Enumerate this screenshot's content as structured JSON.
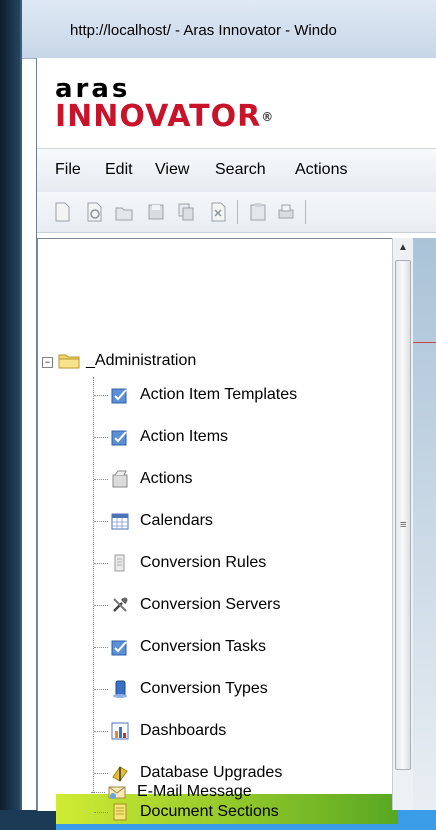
{
  "window": {
    "title": "http://localhost/ - Aras Innovator - Windo"
  },
  "logo": {
    "top": "aras",
    "main": "INNOVATOR",
    "reg": "®"
  },
  "menu": [
    "File",
    "Edit",
    "View",
    "Search",
    "Actions"
  ],
  "toolbar": {
    "icons": [
      "new-document-icon",
      "view-icon",
      "open-icon",
      "save-icon",
      "copy-icon",
      "delete-icon",
      "clipboard-icon",
      "print-icon"
    ]
  },
  "tree": {
    "root": {
      "label": "_Administration",
      "expander": "−"
    },
    "items": [
      {
        "label": "Action Item Templates",
        "icon": "action-item-templates-icon"
      },
      {
        "label": "Action Items",
        "icon": "action-items-icon"
      },
      {
        "label": "Actions",
        "icon": "actions-icon"
      },
      {
        "label": "Calendars",
        "icon": "calendar-icon"
      },
      {
        "label": "Conversion Rules",
        "icon": "conversion-rules-icon"
      },
      {
        "label": "Conversion Servers",
        "icon": "conversion-servers-icon"
      },
      {
        "label": "Conversion Tasks",
        "icon": "conversion-tasks-icon"
      },
      {
        "label": "Conversion Types",
        "icon": "conversion-types-icon"
      },
      {
        "label": "Dashboards",
        "icon": "dashboards-icon"
      },
      {
        "label": "Database Upgrades",
        "icon": "database-upgrades-icon"
      },
      {
        "label": "Document Sections",
        "icon": "document-sections-icon",
        "selected": true
      },
      {
        "label": "E-Mail Message",
        "icon": "email-message-icon"
      }
    ]
  },
  "scrollbar": {
    "up_arrow": "▲",
    "grip": "≡"
  },
  "colors": {
    "selection": "#3b9de8",
    "highlight_yellow": "#d8ef2a",
    "logo_red": "#c8142b"
  }
}
